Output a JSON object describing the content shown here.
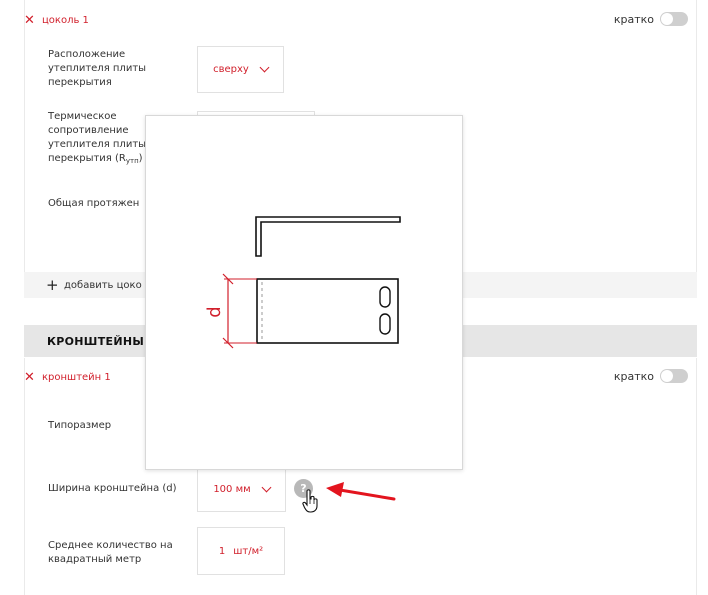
{
  "plinth_block": {
    "item_title": "цоколь 1",
    "brief_label": "кратко",
    "insulation_location": {
      "label": "Расположение утеплителя плиты перекрытия",
      "value": "сверху"
    },
    "thermal_resistance": {
      "label_main": "Термическое сопротивление утеплителя плиты перекрытия (R",
      "label_sub": "утп",
      "label_end": ")"
    },
    "total_length": {
      "label": "Общая протяжен"
    },
    "add_label": "добавить цоко"
  },
  "brackets_section": {
    "title": "КРОНШТЕЙНЫ",
    "item_title": "кронштейн 1",
    "brief_label": "кратко",
    "size_type": {
      "label": "Типоразмер"
    },
    "width": {
      "label": "Ширина кронштейна (d)",
      "value": "100 мм"
    },
    "avg_count": {
      "label": "Среднее количество на квадратный метр",
      "value": "1",
      "unit": "шт/м²"
    },
    "help_glyph": "?"
  },
  "popup": {
    "dimension_label": "d"
  },
  "colors": {
    "accent": "#d11f2b",
    "section_bg": "#e6e6e6",
    "add_bg": "#f4f4f4"
  }
}
